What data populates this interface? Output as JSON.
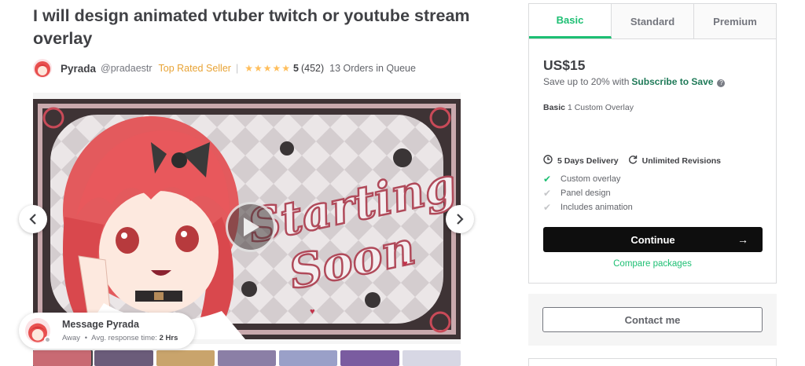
{
  "gig": {
    "title": "I will design animated vtuber twitch or youtube stream overlay"
  },
  "seller": {
    "name": "Pyrada",
    "handle": "@pradaestr",
    "badge": "Top Rated Seller",
    "separator": "|",
    "stars": "★★★★★",
    "rating": "5",
    "reviews": "(452)",
    "queue": "13 Orders in Queue"
  },
  "gallery": {
    "artwork_text_line1": "Starting",
    "artwork_text_line2": "Soon",
    "prev_icon": "chevron-left-icon",
    "next_icon": "chevron-right-icon",
    "play_icon": "play-icon"
  },
  "message": {
    "title": "Message Pyrada",
    "status": "Away",
    "dot": "•",
    "response_label": "Avg. response time:",
    "response_value": "2 Hrs"
  },
  "package": {
    "tabs": [
      {
        "label": "Basic",
        "active": true
      },
      {
        "label": "Standard",
        "active": false
      },
      {
        "label": "Premium",
        "active": false
      }
    ],
    "price": "US$15",
    "save_prefix": "Save up to 20% with",
    "save_link": "Subscribe to Save",
    "help_icon": "?",
    "desc_label": "Basic",
    "desc_text": "1 Custom Overlay",
    "delivery": "5 Days Delivery",
    "revisions": "Unlimited Revisions",
    "features": [
      {
        "label": "Custom overlay",
        "included": true
      },
      {
        "label": "Panel design",
        "included": false
      },
      {
        "label": "Includes animation",
        "included": false
      }
    ],
    "continue_label": "Continue",
    "continue_arrow": "→",
    "compare_label": "Compare packages"
  },
  "contact": {
    "label": "Contact me"
  },
  "colors": {
    "brand_green": "#1dbf73",
    "star": "#ffbe5b",
    "top_rated": "#e8a335"
  }
}
